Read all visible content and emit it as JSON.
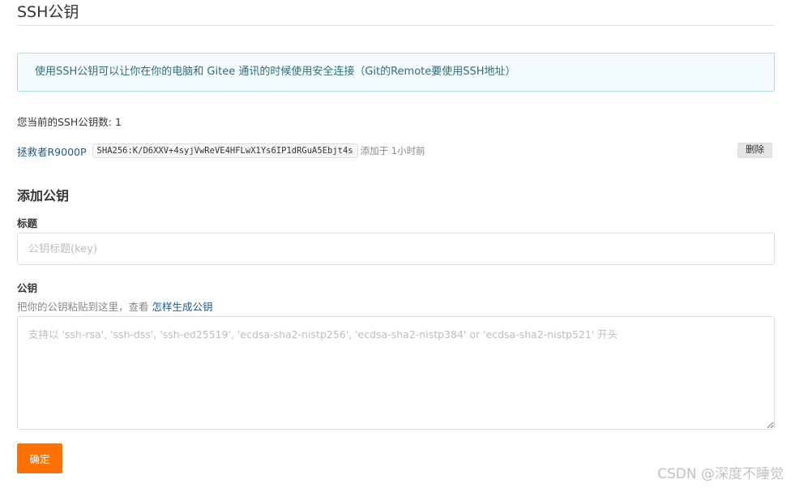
{
  "page": {
    "title": "SSH公钥"
  },
  "info_box": {
    "text": "使用SSH公钥可以让你在你的电脑和 Gitee 通讯的时候使用安全连接（Git的Remote要使用SSH地址）"
  },
  "key_count": {
    "text": "您当前的SSH公钥数: 1"
  },
  "keys": [
    {
      "name": "拯救者R9000P",
      "fingerprint": "SHA256:K/D6XXV+4syjVwReVE4HFLwX1Ys6IP1dRGuA5Ebjt4s",
      "added": "添加于 1小时前",
      "delete_label": "删除"
    }
  ],
  "add_section": {
    "title": "添加公钥",
    "title_label": "标题",
    "title_placeholder": "公钥标题(key)",
    "key_label": "公钥",
    "hint_text": "把你的公钥粘贴到这里，查看 ",
    "hint_link": "怎样生成公钥",
    "key_placeholder": "支持以 'ssh-rsa', 'ssh-dss', 'ssh-ed25519', 'ecdsa-sha2-nistp256', 'ecdsa-sha2-nistp384' or 'ecdsa-sha2-nistp521' 开头",
    "submit_label": "确定"
  },
  "watermark": {
    "text": "CSDN @深度不睡觉"
  },
  "colors": {
    "accent": "#fe7300",
    "link": "#1a5a8a",
    "info_border": "#a6d9e2",
    "info_bg": "#f4fcfd"
  }
}
